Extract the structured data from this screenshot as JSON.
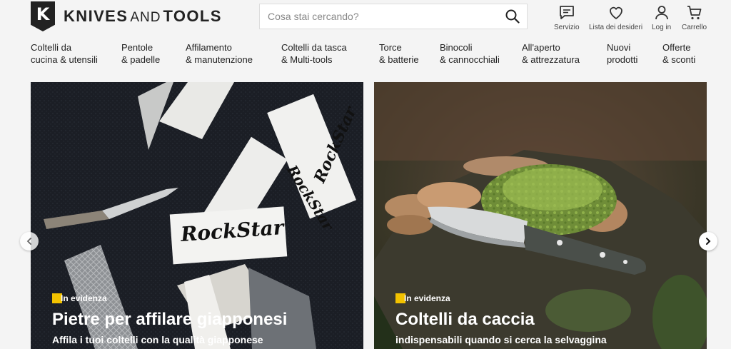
{
  "brand": {
    "badge": "K",
    "name_part1": "KNIVES",
    "name_part2": "AND",
    "name_part3": "TOOLS"
  },
  "search": {
    "placeholder": "Cosa stai cercando?",
    "icon": "search-icon"
  },
  "utilities": [
    {
      "label": "Servizio",
      "icon": "chat-icon"
    },
    {
      "label": "Lista dei desideri",
      "icon": "heart-icon"
    },
    {
      "label": "Log in",
      "icon": "user-icon"
    },
    {
      "label": "Carrello",
      "icon": "cart-icon"
    }
  ],
  "nav": [
    {
      "line1": "Coltelli da",
      "line2": "cucina & utensili"
    },
    {
      "line1": "Pentole",
      "line2": "& padelle"
    },
    {
      "line1": "Affilamento",
      "line2": "& manutenzione"
    },
    {
      "line1": "Coltelli da tasca",
      "line2": "& Multi-tools"
    },
    {
      "line1": "Torce",
      "line2": "& batterie"
    },
    {
      "line1": "Binocoli",
      "line2": "& cannocchiali"
    },
    {
      "line1": "All'aperto",
      "line2": "& attrezzatura"
    },
    {
      "line1": "Nuovi",
      "line2": "prodotti"
    },
    {
      "line1": "Offerte",
      "line2": "& sconti"
    }
  ],
  "banners": [
    {
      "tag": "In evidenza",
      "title": "Pietre per affilare giapponesi",
      "subtitle": "Affila i tuoi coltelli con la qualità giapponese"
    },
    {
      "tag": "In evidenza",
      "title": "Coltelli da caccia",
      "subtitle": "indispensabili quando si cerca la selvaggina"
    }
  ],
  "stone_labels": [
    "RockStar",
    "RockStar",
    "RockStar"
  ],
  "carousel": {
    "prev_icon": "chevron-left-icon",
    "next_icon": "chevron-right-icon"
  },
  "colors": {
    "accent": "#f2c200",
    "brand": "#222222"
  }
}
